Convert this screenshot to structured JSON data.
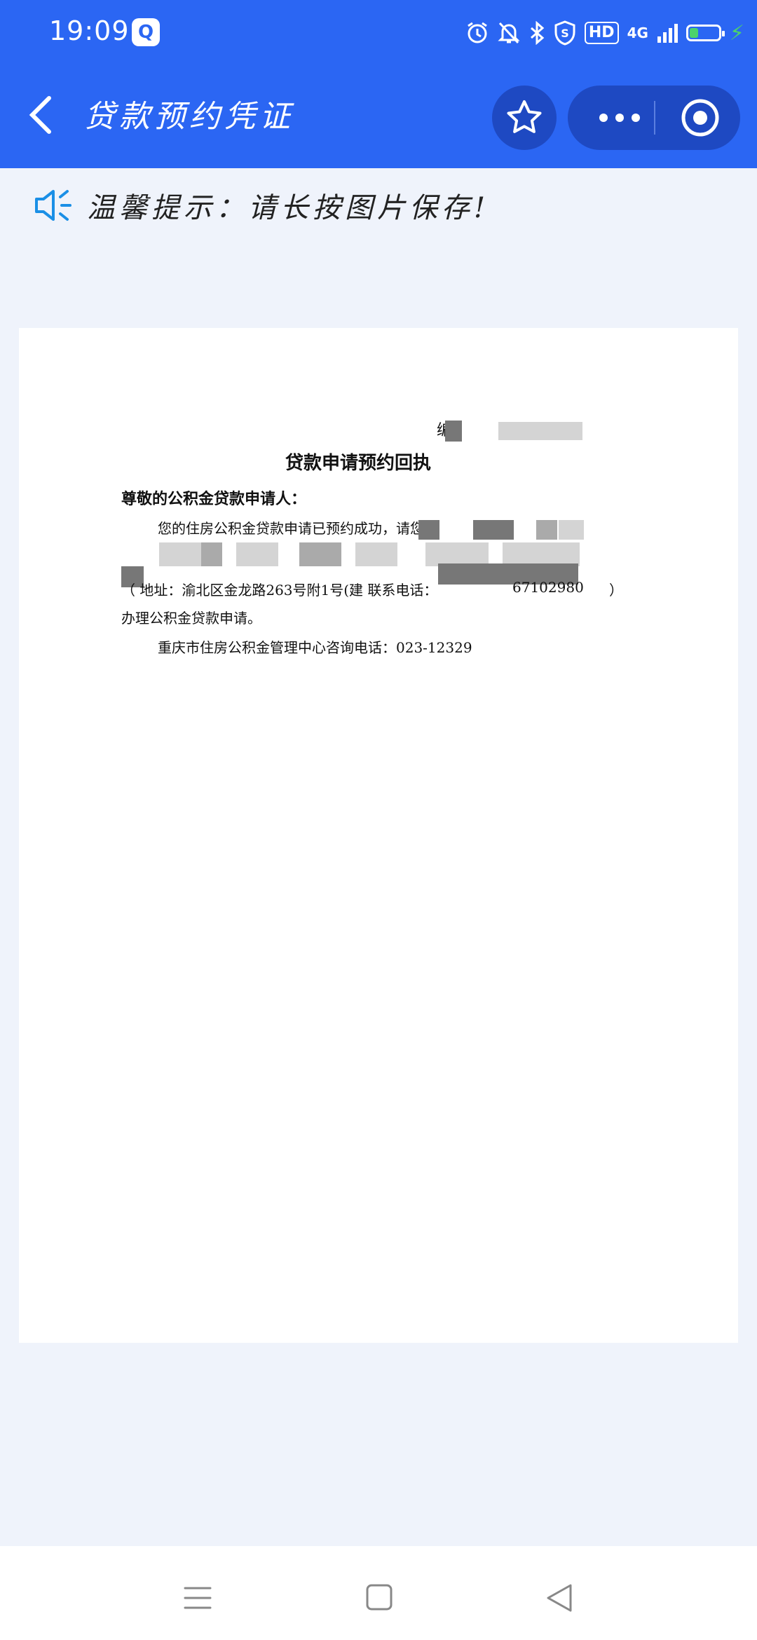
{
  "status": {
    "time": "19:09",
    "app_icon_glyph": "Q",
    "hd": "HD",
    "network": "4G"
  },
  "header": {
    "title": "贷款预约凭证"
  },
  "tip": {
    "text": "温馨提示：请长按图片保存!"
  },
  "document": {
    "number_label": "编",
    "heading": "贷款申请预约回执",
    "salutation": "尊敬的公积金贷款申请人：",
    "line1": "您的住房公积金贷款申请已预约成功，请您",
    "address_line": "（ 地址：渝北区金龙路263号附1号(建 联系电话：",
    "phone": "67102980",
    "close_paren": "）",
    "line_apply": "办理公积金贷款申请。",
    "hotline": "重庆市住房公积金管理中心咨询电话：023-12329"
  },
  "colors": {
    "header_bg": "#2b66f3",
    "capsule_bg": "#1e49c2",
    "page_bg": "#eff3fb",
    "battery": "#4bd36b"
  },
  "icons": {
    "back": "chevron-left-icon",
    "favorite": "star-icon",
    "more": "more-dots-icon",
    "close_target": "target-icon",
    "speaker": "speaker-icon",
    "nav_menu": "menu-icon",
    "nav_home": "square-icon",
    "nav_back": "triangle-back-icon"
  }
}
